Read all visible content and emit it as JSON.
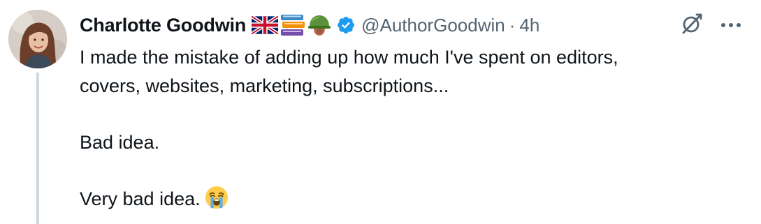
{
  "author": {
    "display_name": "Charlotte Goodwin",
    "name_emojis": [
      "uk-flag-icon",
      "books-icon",
      "military-helmet-icon"
    ],
    "verified": true,
    "handle": "@AuthorGoodwin",
    "separator": "·",
    "timestamp": "4h"
  },
  "post": {
    "line1": "I made the mistake of adding up how much I've spent on editors,",
    "line2": "covers, websites, marketing, subscriptions...",
    "line3": "Bad idea.",
    "line4": "Very bad idea.",
    "trailing_emoji": "loudly-crying-face-icon"
  },
  "actions": {
    "grok_icon": "grok-icon",
    "more_icon": "more-horizontal-icon"
  },
  "colors": {
    "text": "#0f1419",
    "secondary_text": "#536471",
    "verified_blue": "#1d9bf0",
    "thread_line": "#cfd9de"
  }
}
